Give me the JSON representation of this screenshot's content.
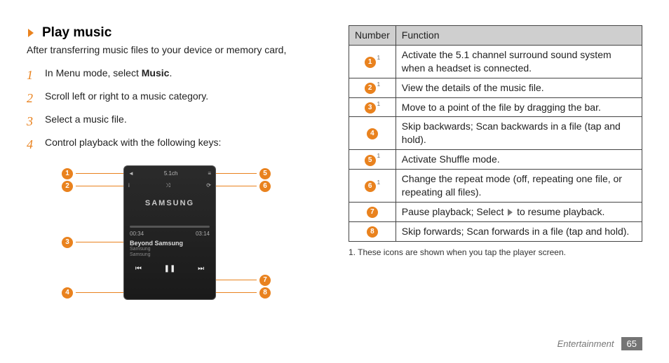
{
  "heading": "Play music",
  "intro": "After transferring music files to your device or memory card,",
  "steps": [
    {
      "num": "1",
      "pre": "In Menu mode, select ",
      "bold": "Music",
      "post": "."
    },
    {
      "num": "2",
      "pre": "Scroll left or right to a music category.",
      "bold": "",
      "post": ""
    },
    {
      "num": "3",
      "pre": "Select a music file.",
      "bold": "",
      "post": ""
    },
    {
      "num": "4",
      "pre": "Control playback with the following keys:",
      "bold": "",
      "post": ""
    }
  ],
  "screen": {
    "brand": "SAMSUNG",
    "surround": "5.1ch",
    "time_elapsed": "00:34",
    "time_total": "03:14",
    "song_title": "Beyond Samsung",
    "song_artist": "Samsung",
    "song_album": "Samsung",
    "prev": "⏮",
    "play": "❚❚",
    "next": "⏭",
    "info_icon": "i",
    "shuffle_icon": "⤨",
    "repeat_icon": "⟳"
  },
  "callouts": {
    "c1": "1",
    "c2": "2",
    "c3": "3",
    "c4": "4",
    "c5": "5",
    "c6": "6",
    "c7": "7",
    "c8": "8"
  },
  "table": {
    "head_num": "Number",
    "head_fn": "Function",
    "rows": [
      {
        "n": "1",
        "sup": "1",
        "fn": "Activate the 5.1 channel surround sound system when a headset is connected."
      },
      {
        "n": "2",
        "sup": "1",
        "fn": "View the details of the music file."
      },
      {
        "n": "3",
        "sup": "1",
        "fn": "Move to a point of the file by dragging the bar."
      },
      {
        "n": "4",
        "sup": "",
        "fn": "Skip backwards; Scan backwards in a file (tap and hold)."
      },
      {
        "n": "5",
        "sup": "1",
        "fn": "Activate Shuffle mode."
      },
      {
        "n": "6",
        "sup": "1",
        "fn": "Change the repeat mode (off, repeating one file, or repeating all files)."
      },
      {
        "n": "7",
        "sup": "",
        "fn_pre": "Pause playback; Select ",
        "fn_post": " to resume playback."
      },
      {
        "n": "8",
        "sup": "",
        "fn": "Skip forwards; Scan forwards in a file (tap and hold)."
      }
    ]
  },
  "footnote": "1. These icons are shown when you tap the player screen.",
  "footer_section": "Entertainment",
  "footer_page": "65"
}
